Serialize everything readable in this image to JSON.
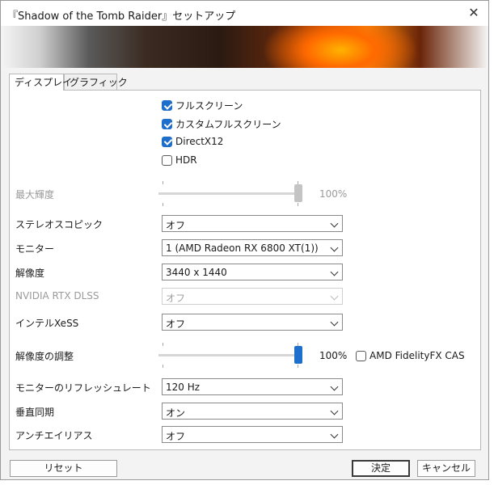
{
  "window": {
    "title": "『Shadow of the Tomb Raider』セットアップ",
    "close_glyph": "✕"
  },
  "tabs": [
    {
      "label": "ディスプレイ",
      "active": true
    },
    {
      "label": "グラフィック",
      "active": false
    }
  ],
  "checkboxes": [
    {
      "label": "フルスクリーン",
      "checked": true
    },
    {
      "label": "カスタムフルスクリーン",
      "checked": true
    },
    {
      "label": "DirectX12",
      "checked": true
    },
    {
      "label": "HDR",
      "checked": false
    }
  ],
  "settings": {
    "max_brightness": {
      "label": "最大輝度",
      "value": "100%",
      "level": 1.0,
      "disabled": true
    },
    "stereoscopic": {
      "label": "ステレオスコピック",
      "value": "オフ"
    },
    "monitor": {
      "label": "モニター",
      "value": "1 (AMD Radeon RX 6800 XT(1))"
    },
    "resolution": {
      "label": "解像度",
      "value": "3440 x 1440"
    },
    "dlss": {
      "label": "NVIDIA RTX DLSS",
      "value": "オフ",
      "disabled": true
    },
    "xess": {
      "label": "インテルXeSS",
      "value": "オフ"
    },
    "res_scale": {
      "label": "解像度の調整",
      "value": "100%",
      "level": 1.0
    },
    "fidelityfx_cas": {
      "label": "AMD FidelityFX CAS",
      "checked": false
    },
    "refresh_rate": {
      "label": "モニターのリフレッシュレート",
      "value": "120 Hz"
    },
    "vsync": {
      "label": "垂直同期",
      "value": "オン"
    },
    "antialiasing": {
      "label": "アンチエイリアス",
      "value": "オフ"
    }
  },
  "buttons": {
    "reset": "リセット",
    "ok": "決定",
    "cancel": "キャンセル"
  },
  "colors": {
    "accent": "#1e6ecc",
    "disabled_thumb": "#c4c4c4"
  }
}
